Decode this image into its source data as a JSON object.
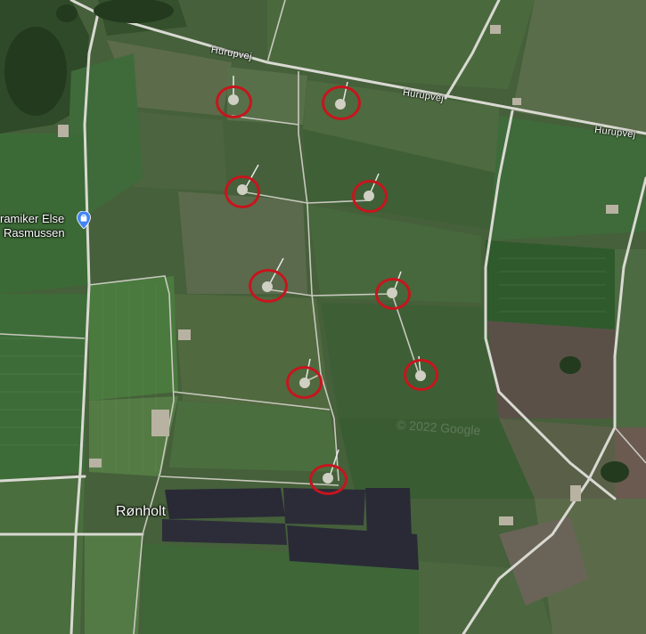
{
  "roads": [
    {
      "label": "Hurupvej"
    },
    {
      "label": "Hurupvej"
    },
    {
      "label": "Hurupvej"
    }
  ],
  "poi": {
    "name_line1": "ramiker Else",
    "name_line2": "Rasmussen",
    "icon": "shopping-bag-pin-icon",
    "pin_color": "#4285f4"
  },
  "place": {
    "name": "Rønholt"
  },
  "markers": {
    "color": "#c7151d",
    "count": 9,
    "description": "red circles marking wind turbines"
  },
  "watermark": {
    "text": "© 2022 Google"
  }
}
